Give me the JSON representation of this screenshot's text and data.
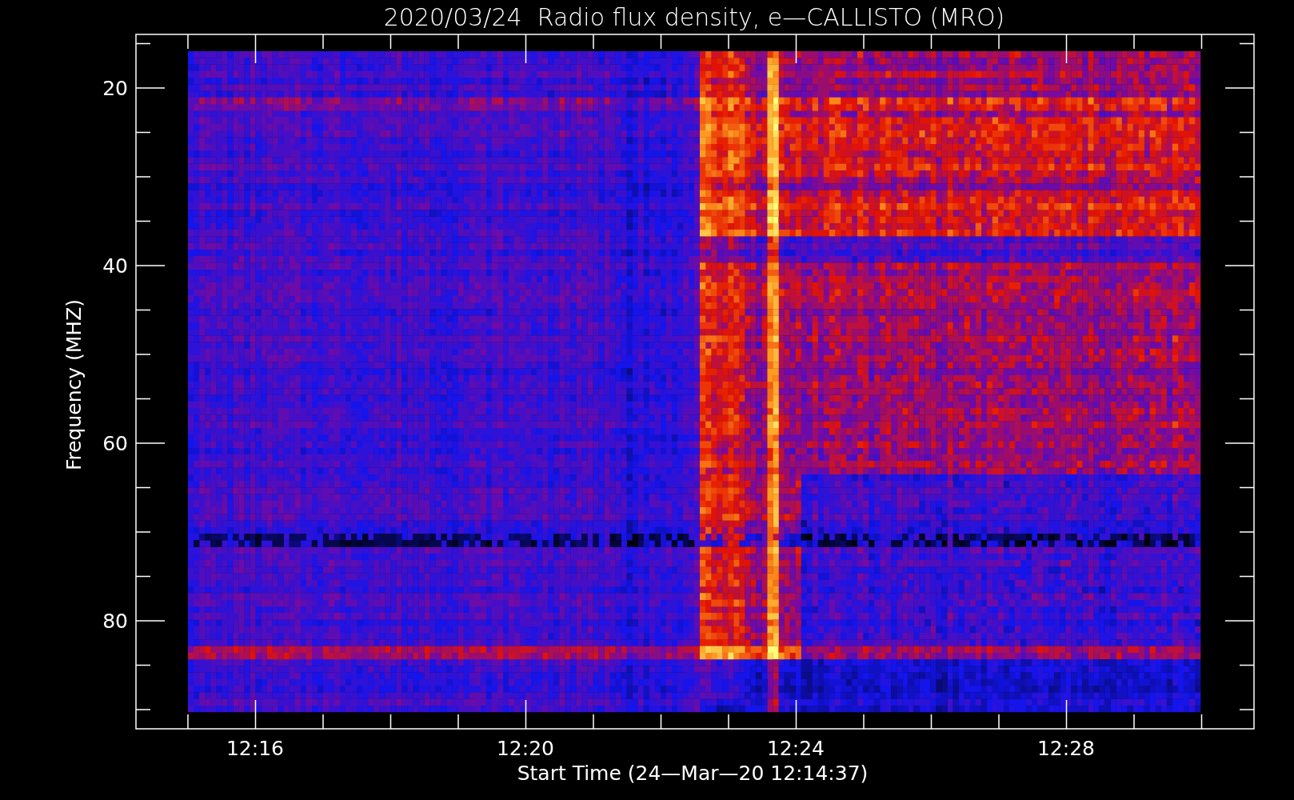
{
  "title": "2020/03/24  Radio flux density, e—CALLISTO (MRO)",
  "y_axis": {
    "label": "Frequency (MHZ)",
    "ticks": [
      "20",
      "40",
      "60",
      "80"
    ]
  },
  "x_axis": {
    "label": "Start Time (24—Mar—20 12:14:37)",
    "ticks": [
      "12:16",
      "12:20",
      "12:24",
      "12:28"
    ]
  }
}
